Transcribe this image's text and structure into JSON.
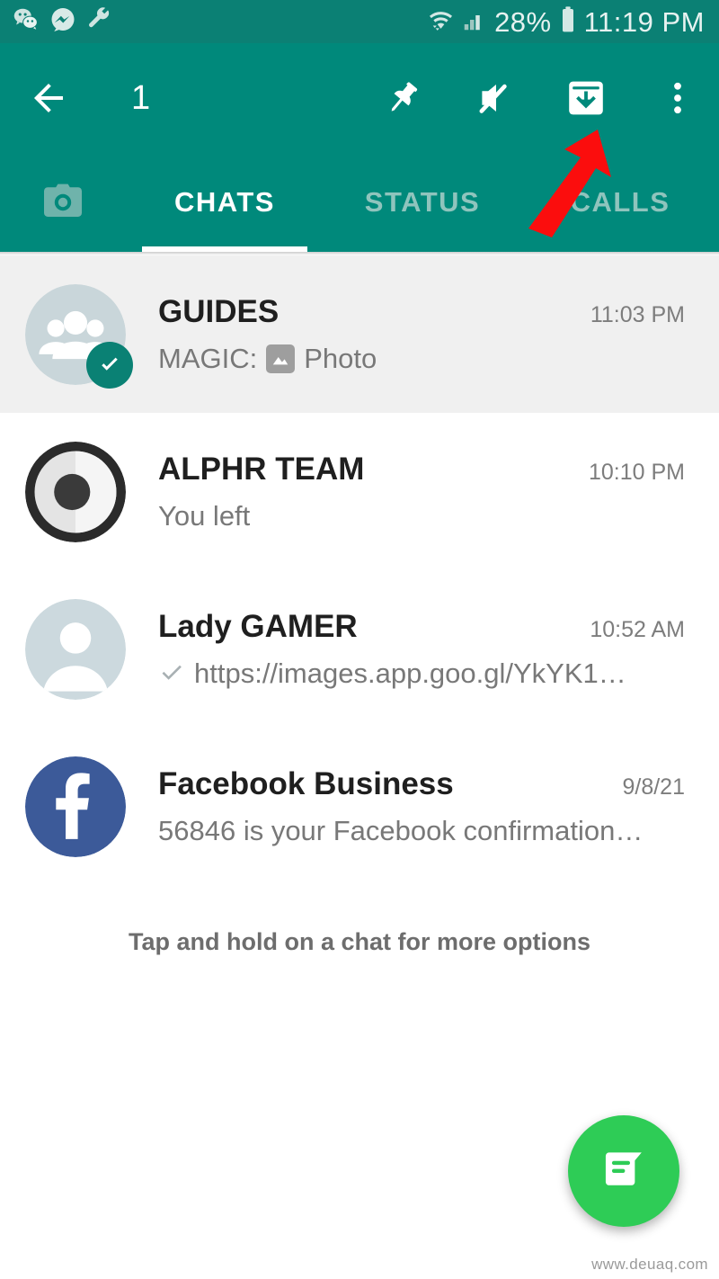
{
  "status_bar": {
    "time": "11:19 PM",
    "battery_percent": "28%",
    "left_icons": [
      "wechat-icon",
      "messenger-icon",
      "wrench-icon"
    ],
    "right_icons": [
      "wifi-icon",
      "cellular-signal-icon",
      "battery-icon"
    ],
    "background_color": "#0b8074",
    "text_color": "#e6f2f0"
  },
  "action_bar": {
    "back_label": "back-arrow",
    "selected_count": "1",
    "actions": [
      {
        "name": "pin-icon",
        "label": "Pin"
      },
      {
        "name": "mute-icon",
        "label": "Mute"
      },
      {
        "name": "archive-icon",
        "label": "Archive"
      },
      {
        "name": "overflow-menu-icon",
        "label": "More options"
      }
    ],
    "background_color": "#00897b"
  },
  "annotation": {
    "arrow_color": "#fb0d0d",
    "points_to": "archive-icon"
  },
  "tabs": {
    "camera_label": "Camera",
    "items": [
      {
        "label": "CHATS",
        "active": true
      },
      {
        "label": "STATUS",
        "active": false
      },
      {
        "label": "CALLS",
        "active": false
      }
    ],
    "active_color": "#ffffff",
    "inactive_color": "#8fc4bd"
  },
  "chats": [
    {
      "name": "GUIDES",
      "sender_prefix": "MAGIC:",
      "preview": "Photo",
      "preview_icon": "image-icon",
      "time": "11:03 PM",
      "selected": true,
      "avatar_type": "group",
      "tick": false
    },
    {
      "name": "ALPHR TEAM",
      "sender_prefix": "",
      "preview": "You left",
      "preview_icon": null,
      "time": "10:10 PM",
      "selected": false,
      "avatar_type": "ring",
      "tick": false
    },
    {
      "name": "Lady GAMER",
      "sender_prefix": "",
      "preview": "https://images.app.goo.gl/YkYK1…",
      "preview_icon": null,
      "time": "10:52 AM",
      "selected": false,
      "avatar_type": "person",
      "tick": true
    },
    {
      "name": "Facebook Business",
      "sender_prefix": "",
      "preview": "56846 is your Facebook confirmation…",
      "preview_icon": null,
      "time": "9/8/21",
      "selected": false,
      "avatar_type": "facebook",
      "tick": false
    }
  ],
  "hint": {
    "text": "Tap and hold on a chat for more options"
  },
  "fab": {
    "name": "new-chat-button",
    "icon": "new-message-icon",
    "color": "#2ecc56"
  },
  "watermark": {
    "text": "www.deuaq.com"
  }
}
